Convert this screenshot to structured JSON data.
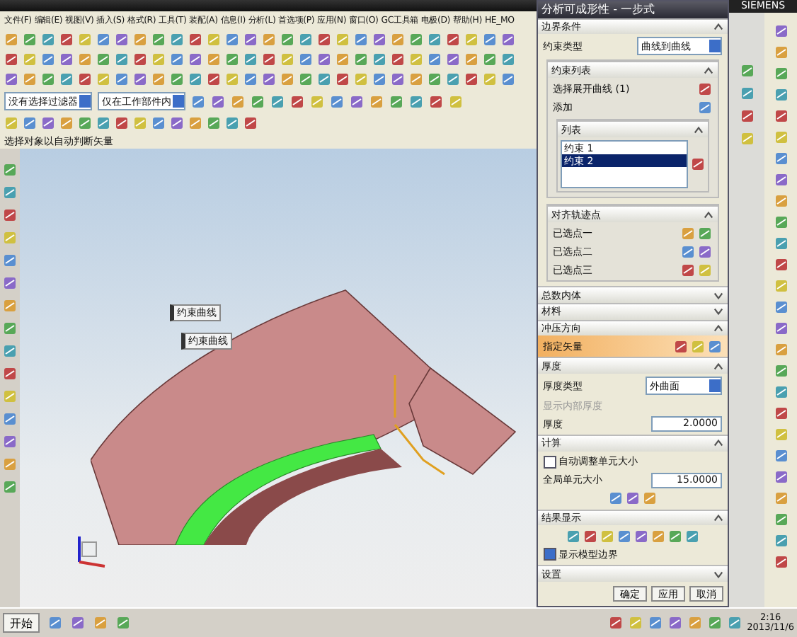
{
  "window": {
    "brand": "SIEMENS"
  },
  "menu": [
    "文件(F)",
    "编辑(E)",
    "视图(V)",
    "插入(S)",
    "格式(R)",
    "工具(T)",
    "装配(A)",
    "信息(I)",
    "分析(L)",
    "首选项(P)",
    "应用(N)",
    "窗口(O)",
    "GC工具箱",
    "电极(D)",
    "帮助(H)",
    "HE_MO"
  ],
  "filters": [
    "没有选择过滤器",
    "仅在工作部件内"
  ],
  "status": "选择对象以自动判断矢量",
  "viewport": {
    "labels": [
      "约束曲线",
      "约束曲线"
    ]
  },
  "dialog": {
    "title": "分析可成形性 - 一步式",
    "boundary": {
      "header": "边界条件",
      "expanded": true,
      "type_label": "约束类型",
      "type_value": "曲线到曲线",
      "list_header": "约束列表",
      "select_label": "选择展开曲线 (1)",
      "add_label": "添加",
      "list_title": "列表",
      "items": [
        {
          "label": "约束 1",
          "selected": false
        },
        {
          "label": "约束 2",
          "selected": true
        }
      ],
      "points_header": "对齐轨迹点",
      "points": [
        "已选点一",
        "已选点二",
        "已选点三"
      ]
    },
    "collapsed": [
      {
        "header": "总数内体",
        "expanded": false
      },
      {
        "header": "材料",
        "expanded": false
      }
    ],
    "direction": {
      "header": "冲压方向",
      "expanded": true,
      "vector_label": "指定矢量"
    },
    "thickness": {
      "header": "厚度",
      "expanded": true,
      "type_label": "厚度类型",
      "type_value": "外曲面",
      "inner_label": "显示内部厚度",
      "thickness_label": "厚度",
      "thickness_value": "2.0000"
    },
    "compute": {
      "header": "计算",
      "expanded": true,
      "auto_label": "自动调整单元大小",
      "auto_checked": false,
      "size_label": "全局单元大小",
      "size_value": "15.0000"
    },
    "results": {
      "header": "结果显示",
      "expanded": true,
      "boundary_label": "显示模型边界",
      "boundary_checked": true
    },
    "settings": {
      "header": "设置",
      "expanded": false
    },
    "buttons": [
      "确定",
      "应用",
      "取消"
    ]
  },
  "taskbar": {
    "start": "开始",
    "time": "2:16",
    "date": "2013/11/6"
  }
}
